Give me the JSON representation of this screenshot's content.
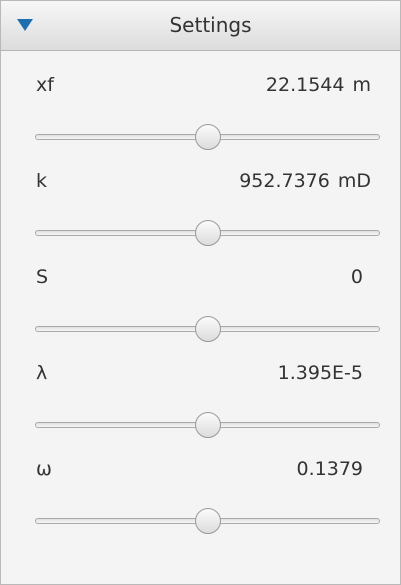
{
  "header": {
    "title": "Settings",
    "toggle_icon": "triangle-down-icon",
    "accent_color": "#1f6fb0"
  },
  "parameters": [
    {
      "label": "xf",
      "value": "22.1544",
      "unit": "m",
      "slider_fraction": 0.5
    },
    {
      "label": "k",
      "value": "952.7376",
      "unit": "mD",
      "slider_fraction": 0.5
    },
    {
      "label": "S",
      "value": "0",
      "unit": "",
      "slider_fraction": 0.5
    },
    {
      "label": "λ",
      "value": "1.395E-5",
      "unit": "",
      "slider_fraction": 0.5
    },
    {
      "label": "ω",
      "value": "0.1379",
      "unit": "",
      "slider_fraction": 0.5
    }
  ]
}
